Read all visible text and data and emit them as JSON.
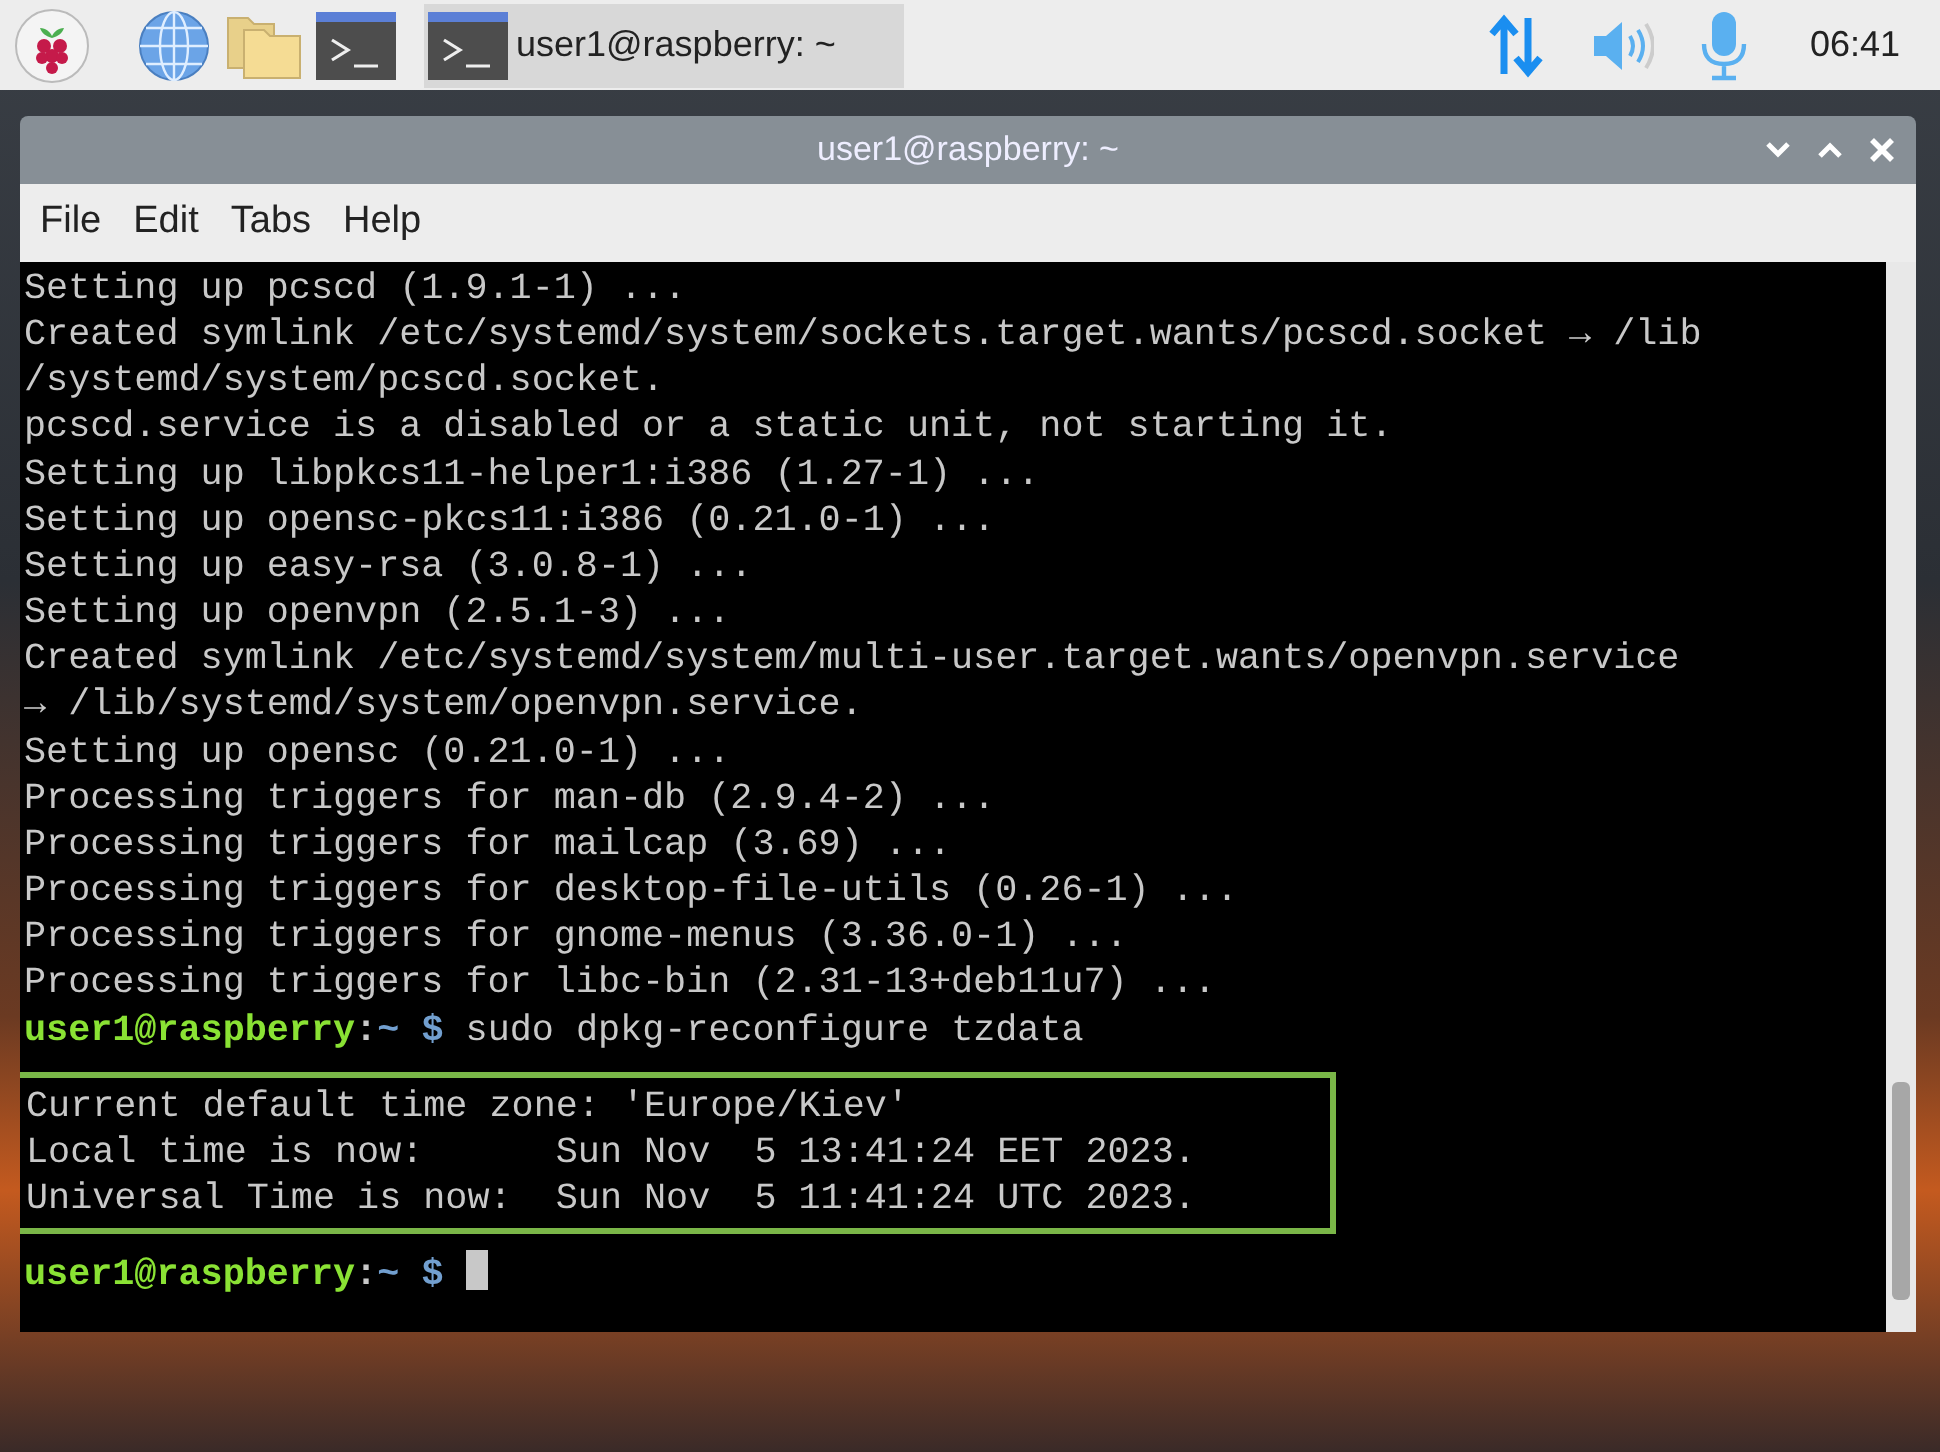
{
  "taskbar": {
    "task": {
      "label": "user1@raspberry: ~",
      "selected": true
    },
    "clock": "06:41"
  },
  "window": {
    "title": "user1@raspberry: ~",
    "menu": [
      "File",
      "Edit",
      "Tabs",
      "Help"
    ],
    "terminal": [
      {
        "kind": "output",
        "text": "Setting up pcscd (1.9.1-1) ..."
      },
      {
        "kind": "output",
        "text": "Created symlink /etc/systemd/system/sockets.target.wants/pcscd.socket → /lib"
      },
      {
        "kind": "output",
        "text": "/systemd/system/pcscd.socket."
      },
      {
        "kind": "output",
        "text": "pcscd.service is a disabled or a static unit, not starting it."
      },
      {
        "kind": "output",
        "text": "Setting up libpkcs11-helper1:i386 (1.27-1) ..."
      },
      {
        "kind": "output",
        "text": "Setting up opensc-pkcs11:i386 (0.21.0-1) ..."
      },
      {
        "kind": "output",
        "text": "Setting up easy-rsa (3.0.8-1) ..."
      },
      {
        "kind": "output",
        "text": "Setting up openvpn (2.5.1-3) ..."
      },
      {
        "kind": "output",
        "text": "Created symlink /etc/systemd/system/multi-user.target.wants/openvpn.service"
      },
      {
        "kind": "output",
        "text": "→ /lib/systemd/system/openvpn.service."
      },
      {
        "kind": "output",
        "text": "Setting up opensc (0.21.0-1) ..."
      },
      {
        "kind": "output",
        "text": "Processing triggers for man-db (2.9.4-2) ..."
      },
      {
        "kind": "output",
        "text": "Processing triggers for mailcap (3.69) ..."
      },
      {
        "kind": "output",
        "text": "Processing triggers for desktop-file-utils (0.26-1) ..."
      },
      {
        "kind": "output",
        "text": "Processing triggers for gnome-menus (3.36.0-1) ..."
      },
      {
        "kind": "output",
        "text": "Processing triggers for libc-bin (2.31-13+deb11u7) ..."
      },
      {
        "kind": "prompt",
        "user": "user1@raspberry",
        "separator": ":",
        "path": "~",
        "symbol": "$",
        "command": "sudo dpkg-reconfigure tzdata",
        "cursor": false
      },
      {
        "kind": "highlight",
        "lines": [
          "Current default time zone: 'Europe/Kiev'",
          "Local time is now:      Sun Nov  5 13:41:24 EET 2023.",
          "Universal Time is now:  Sun Nov  5 11:41:24 UTC 2023."
        ]
      },
      {
        "kind": "prompt",
        "user": "user1@raspberry",
        "separator": ":",
        "path": "~",
        "symbol": "$",
        "cursor": true
      }
    ]
  }
}
